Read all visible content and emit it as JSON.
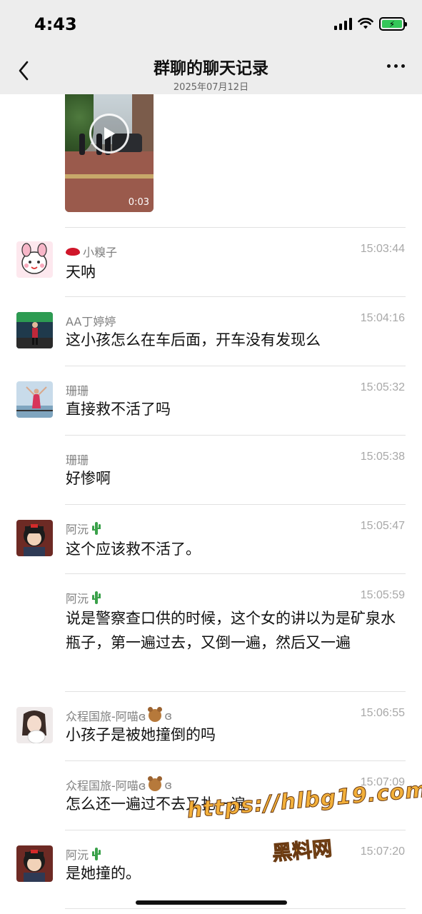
{
  "status_bar": {
    "time": "4:43"
  },
  "header": {
    "title": "群聊的聊天记录",
    "subtitle": "2025年07月12日"
  },
  "video": {
    "duration": "0:03"
  },
  "messages": [
    {
      "sender": "小糗子",
      "time": "15:03:44",
      "text": "天呐",
      "badge_icon": "lips-emoji"
    },
    {
      "sender": "AA丁婷婷",
      "time": "15:04:16",
      "text": "这小孩怎么在车后面，开车没有发现么"
    },
    {
      "sender": "珊珊",
      "time": "15:05:32",
      "text": "直接救不活了吗"
    },
    {
      "sender": "珊珊",
      "time": "15:05:38",
      "text": "好惨啊"
    },
    {
      "sender": "阿沅",
      "time": "15:05:47",
      "text": "这个应该救不活了。",
      "badge_icon": "cactus-emoji"
    },
    {
      "sender": "阿沅",
      "time": "15:05:59",
      "text": "说是警察查口供的时候，这个女的讲以为是矿泉水瓶子，第一遍过去，又倒一遍，然后又一遍",
      "badge_icon": "cactus-emoji"
    },
    {
      "sender": "众程国旅-阿喵ɞ",
      "sender_suffix": "ɞ",
      "time": "15:06:55",
      "text": "小孩子是被她撞倒的吗",
      "badge_icon": "bear-emoji"
    },
    {
      "sender": "众程国旅-阿喵ɞ",
      "sender_suffix": "ɞ",
      "time": "15:07:09",
      "text": "怎么还一遍过不去又扎一遍",
      "badge_icon": "bear-emoji"
    },
    {
      "sender": "阿沅",
      "time": "15:07:20",
      "text": "是她撞的。",
      "badge_icon": "cactus-emoji"
    }
  ],
  "watermark": {
    "url": "https://hlbg19.com",
    "name": "黑料网"
  },
  "colors": {
    "header_bg": "#ededed",
    "timestamp": "#a8a8a8",
    "sender": "#808080",
    "watermark": "#f3b03a"
  }
}
